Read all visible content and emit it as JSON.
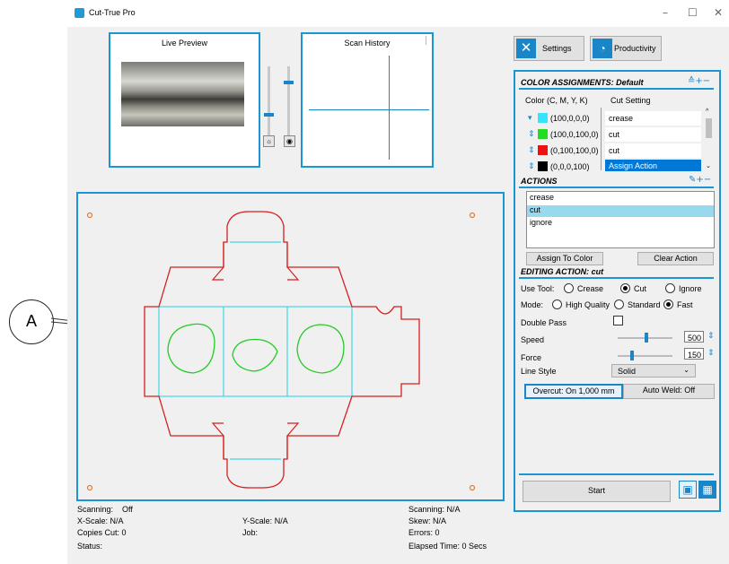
{
  "annotation": {
    "label": "A"
  },
  "window": {
    "title": "Cut-True Pro"
  },
  "live_preview": {
    "title": "Live Preview"
  },
  "scan_history": {
    "title": "Scan History"
  },
  "toolbar": {
    "settings_label": "Settings",
    "productivity_label": "Productivity"
  },
  "color_assignments": {
    "header": "COLOR ASSIGNMENTS: Default",
    "col_color": "Color (C, M, Y, K)",
    "col_cut": "Cut Setting",
    "rows": [
      {
        "cmyk": "(100,0,0,0)",
        "swatch": "#33e3ff",
        "setting": "crease"
      },
      {
        "cmyk": "(100,0,100,0)",
        "swatch": "#22dd22",
        "setting": "cut"
      },
      {
        "cmyk": "(0,100,100,0)",
        "swatch": "#ee1111",
        "setting": "cut"
      },
      {
        "cmyk": "(0,0,0,100)",
        "swatch": "#000000",
        "setting": "Assign Action"
      }
    ]
  },
  "actions": {
    "header": "ACTIONS",
    "items": [
      "crease",
      "cut",
      "ignore"
    ],
    "selected": "cut",
    "assign_label": "Assign To Color",
    "clear_label": "Clear Action"
  },
  "editing": {
    "header": "EDITING ACTION: cut",
    "use_tool_label": "Use Tool:",
    "tool_options": [
      "Crease",
      "Cut",
      "Ignore"
    ],
    "tool_selected": "Cut",
    "mode_label": "Mode:",
    "mode_options": [
      "High Quality",
      "Standard",
      "Fast"
    ],
    "mode_selected": "Fast",
    "double_pass_label": "Double Pass",
    "speed_label": "Speed",
    "speed_value": "500",
    "force_label": "Force",
    "force_value": "150",
    "line_style_label": "Line Style",
    "line_style_value": "Solid",
    "overcut_label": "Overcut: On 1,000 mm",
    "autoweld_label": "Auto Weld: Off"
  },
  "start_label": "Start",
  "status": {
    "scanning_left_label": "Scanning:",
    "scanning_left_value": "Off",
    "xscale": "X-Scale: N/A",
    "copies": "Copies Cut:  0",
    "status_label": "Status:",
    "yscale": "Y-Scale: N/A",
    "job": "Job:",
    "scanning_right": "Scanning:  N/A",
    "skew": "Skew:     N/A",
    "errors": "Errors:   0",
    "elapsed": "Elapsed Time:  0 Secs"
  },
  "colors": {
    "accent": "#1a96d4",
    "die_red": "#d81e1e",
    "fold_cyan": "#3fd7e6",
    "window_green": "#22cc22"
  }
}
